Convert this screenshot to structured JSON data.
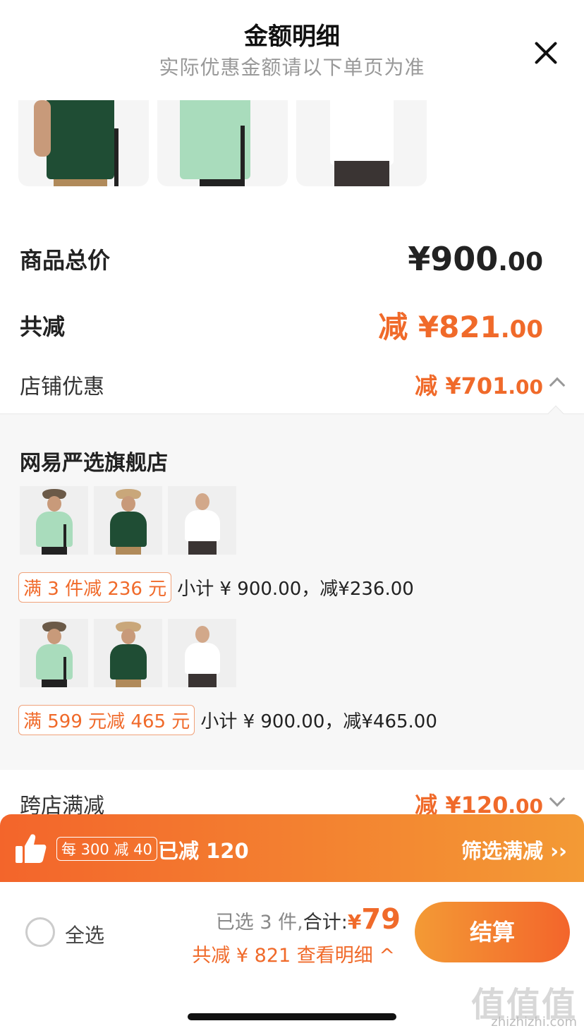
{
  "header": {
    "title": "金额明细",
    "subtitle": "实际优惠金额请以下单页为准"
  },
  "summary": {
    "total_label": "商品总价",
    "total_price_main": "¥900",
    "total_price_decimal": ".00",
    "reduce_label": "共减",
    "reduce_prefix": "减 ¥",
    "reduce_main": "821",
    "reduce_decimal": ".00",
    "store_discount_label": "店铺优惠",
    "store_discount_prefix": "减 ¥",
    "store_discount_main": "701",
    "store_discount_decimal": ".00",
    "cross_store_label": "跨店满减",
    "cross_store_prefix": "减 ¥",
    "cross_store_main": "120",
    "cross_store_decimal": ".00"
  },
  "store": {
    "name": "网易严选旗舰店",
    "promos": [
      {
        "tag": "满 3 件减 236 元",
        "subtotal": "小计 ¥ 900.00，减¥236.00"
      },
      {
        "tag": "满 599 元减 465 元",
        "subtotal": "小计 ¥ 900.00，减¥465.00"
      }
    ]
  },
  "promo_bar": {
    "tag": "每 300 减 40",
    "done": "已减 120",
    "link": "筛选满减 ››"
  },
  "bottom": {
    "select_all": "全选",
    "selected_info": "已选 3 件,",
    "total_label": "合计:",
    "currency": "¥",
    "total_amount": "79",
    "detail_link": "共减 ¥ 821 查看明细 ^",
    "checkout": "结算"
  },
  "watermark": {
    "text": "值值值",
    "site": "zhizhizhi.com"
  },
  "colors": {
    "accent": "#f06a2a",
    "accent_light": "#f39a35",
    "green_shirt": "#1f4d34",
    "mint_shirt": "#a9dcbc",
    "white_shirt": "#f2f2f6"
  }
}
